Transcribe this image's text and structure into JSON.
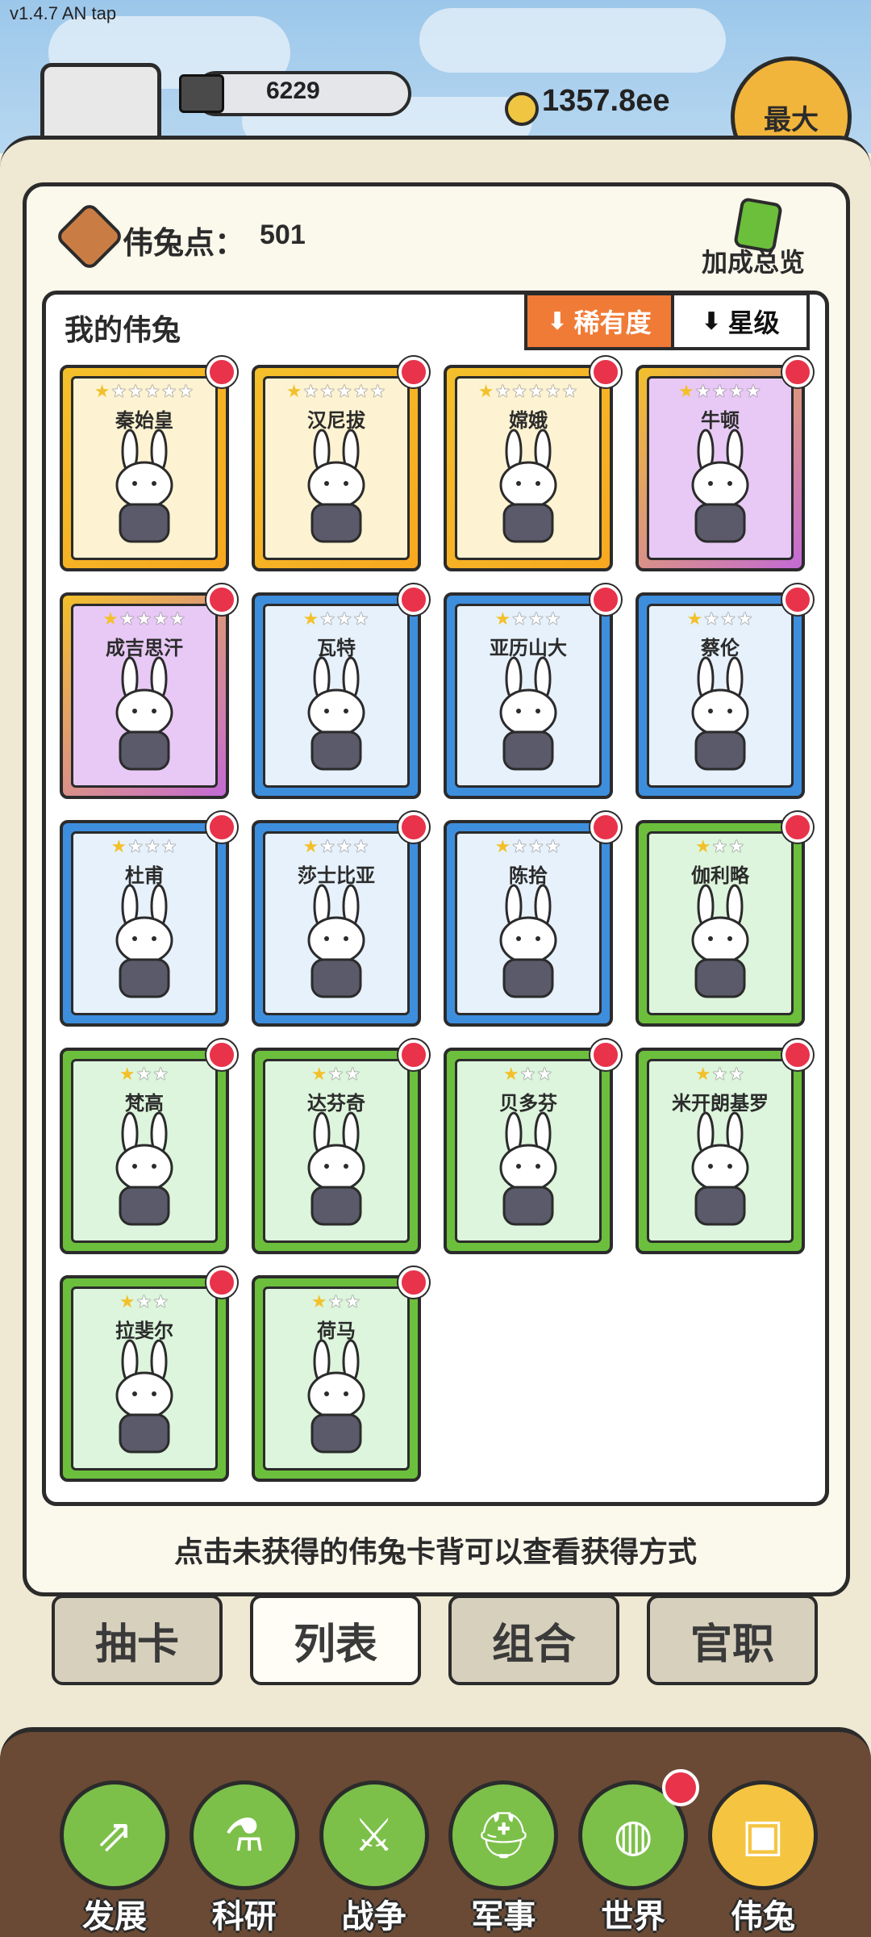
{
  "version": "v1.4.7 AN tap",
  "header": {
    "ingot_value": "6229",
    "coin_value": "1357.8ee",
    "max_label": "最大"
  },
  "points": {
    "label": "伟兔点：",
    "value": "501"
  },
  "bonus_overview_label": "加成总览",
  "list": {
    "title": "我的伟兔",
    "sort_rarity": "稀有度",
    "sort_star": "星级"
  },
  "cards": [
    {
      "name": "秦始皇",
      "stars": 1,
      "max_stars": 6,
      "tier": "gold"
    },
    {
      "name": "汉尼拔",
      "stars": 1,
      "max_stars": 6,
      "tier": "gold"
    },
    {
      "name": "嫦娥",
      "stars": 1,
      "max_stars": 6,
      "tier": "gold"
    },
    {
      "name": "牛顿",
      "stars": 1,
      "max_stars": 5,
      "tier": "purple"
    },
    {
      "name": "成吉思汗",
      "stars": 1,
      "max_stars": 5,
      "tier": "purple"
    },
    {
      "name": "瓦特",
      "stars": 1,
      "max_stars": 4,
      "tier": "blue"
    },
    {
      "name": "亚历山大",
      "stars": 1,
      "max_stars": 4,
      "tier": "blue"
    },
    {
      "name": "蔡伦",
      "stars": 1,
      "max_stars": 4,
      "tier": "blue"
    },
    {
      "name": "杜甫",
      "stars": 1,
      "max_stars": 4,
      "tier": "blue"
    },
    {
      "name": "莎士比亚",
      "stars": 1,
      "max_stars": 4,
      "tier": "blue"
    },
    {
      "name": "陈拾",
      "stars": 1,
      "max_stars": 4,
      "tier": "blue"
    },
    {
      "name": "伽利略",
      "stars": 1,
      "max_stars": 3,
      "tier": "green"
    },
    {
      "name": "梵高",
      "stars": 1,
      "max_stars": 3,
      "tier": "green"
    },
    {
      "name": "达芬奇",
      "stars": 1,
      "max_stars": 3,
      "tier": "green"
    },
    {
      "name": "贝多芬",
      "stars": 1,
      "max_stars": 3,
      "tier": "green"
    },
    {
      "name": "米开朗基罗",
      "stars": 1,
      "max_stars": 3,
      "tier": "green"
    },
    {
      "name": "拉斐尔",
      "stars": 1,
      "max_stars": 3,
      "tier": "green"
    },
    {
      "name": "荷马",
      "stars": 1,
      "max_stars": 3,
      "tier": "green"
    }
  ],
  "hint": "点击未获得的伟兔卡背可以查看获得方式",
  "tabs": [
    {
      "label": "抽卡"
    },
    {
      "label": "列表"
    },
    {
      "label": "组合"
    },
    {
      "label": "官职"
    }
  ],
  "nav": [
    {
      "label": "发展",
      "icon": "develop-icon",
      "glyph": "⇗"
    },
    {
      "label": "科研",
      "icon": "research-flask-icon",
      "glyph": "⚗"
    },
    {
      "label": "战争",
      "icon": "crossed-swords-icon",
      "glyph": "⚔"
    },
    {
      "label": "军事",
      "icon": "military-helmet-icon",
      "glyph": "⛑"
    },
    {
      "label": "世界",
      "icon": "globe-icon",
      "glyph": "◍"
    },
    {
      "label": "伟兔",
      "icon": "bunny-card-icon",
      "glyph": "▣"
    }
  ],
  "colors": {
    "gold": "#f3c02a",
    "purple": "#c46ad6",
    "blue": "#3e8ede",
    "green": "#6cbf3c",
    "accent_orange": "#f07b37",
    "badge_red": "#e8334a"
  }
}
